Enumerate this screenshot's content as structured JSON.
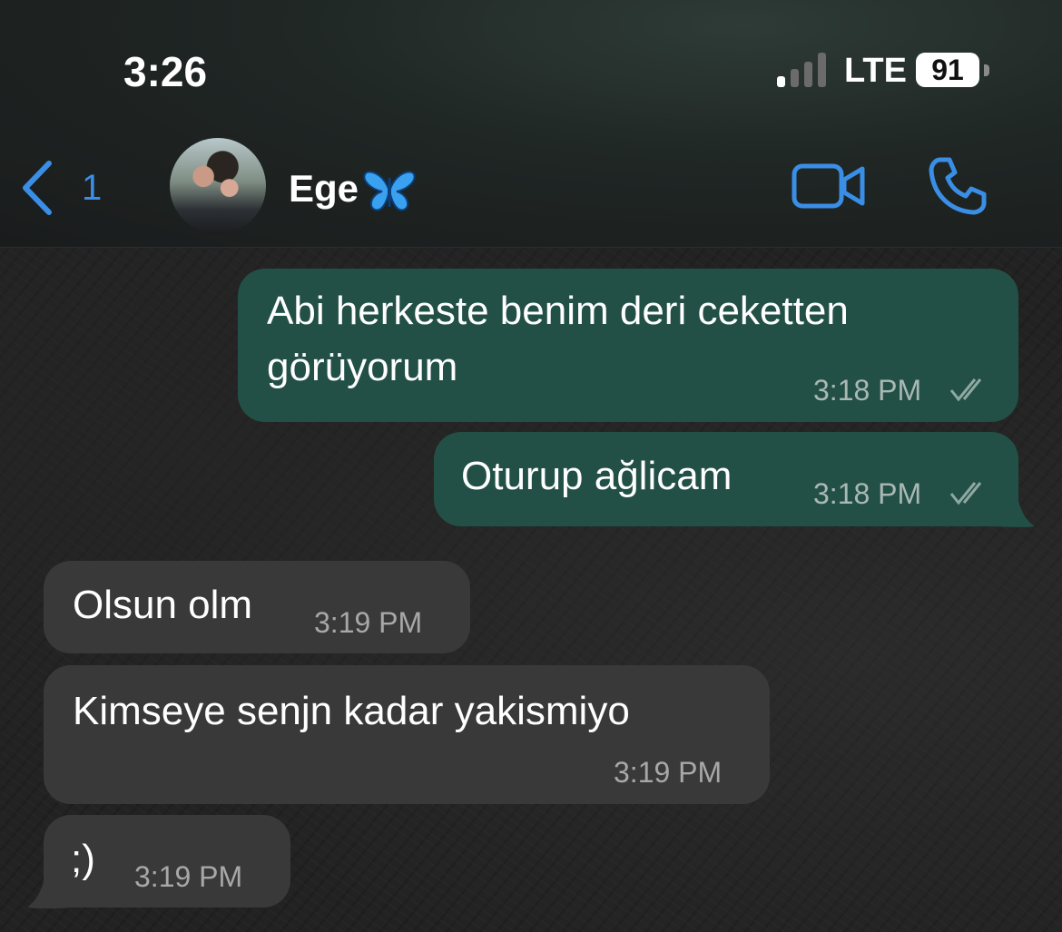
{
  "status_bar": {
    "time": "3:26",
    "network": "LTE",
    "battery": "91"
  },
  "header": {
    "back_count": "1",
    "contact_name": "Ege",
    "icons": [
      "chevron-left-icon",
      "avatar",
      "butterfly-emoji",
      "video-camera-icon",
      "phone-icon"
    ],
    "accent": "#3a8ee6"
  },
  "messages": [
    {
      "direction": "outgoing",
      "text": "Abi herkeste benim deri ceketten\ngörüyorum",
      "time": "3:18 PM",
      "status": "read"
    },
    {
      "direction": "outgoing",
      "text": "Oturup ağlicam",
      "time": "3:18 PM",
      "status": "read"
    },
    {
      "direction": "incoming",
      "text": "Olsun olm",
      "time": "3:19 PM"
    },
    {
      "direction": "incoming",
      "text": "Kimseye senjn kadar yakismiyo",
      "time": "3:19 PM"
    },
    {
      "direction": "incoming",
      "text": ";)",
      "time": "3:19 PM"
    }
  ],
  "colors": {
    "outgoing_bubble": "#225046",
    "incoming_bubble": "#393939",
    "ticks": "#8fa9a2"
  }
}
